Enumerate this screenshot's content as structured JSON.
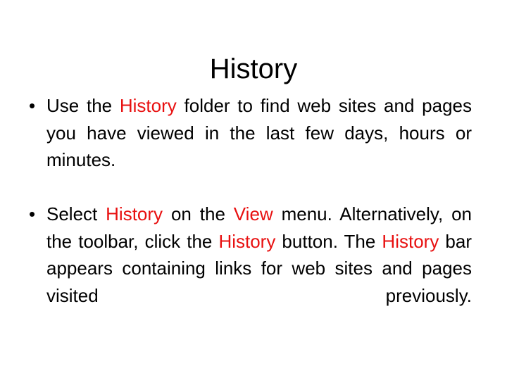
{
  "slide": {
    "title": "History",
    "title_color": "#000000",
    "background_color": "#ffffff",
    "highlight_color": "#e81010",
    "bullet_marker": "•",
    "bullets": [
      {
        "marker": "•",
        "full_text": "Use the History folder to find web sites and pages you have viewed in the last few days, hours or minutes.",
        "segments": [
          {
            "text": "Use the ",
            "highlight": false
          },
          {
            "text": "History",
            "highlight": true
          },
          {
            "text": " folder to find web sites and pages you have viewed in the last few days, hours or minutes.",
            "highlight": false
          }
        ]
      },
      {
        "marker": "•",
        "full_text": "Select History on the View menu. Alternatively, on the toolbar, click the History button. The History bar appears containing links for web sites and pages visited previously.",
        "segments": [
          {
            "text": "Select ",
            "highlight": false
          },
          {
            "text": "History",
            "highlight": true
          },
          {
            "text": " on the ",
            "highlight": false
          },
          {
            "text": "View",
            "highlight": true
          },
          {
            "text": " menu. Alternatively, on the toolbar, click the ",
            "highlight": false
          },
          {
            "text": "History",
            "highlight": true
          },
          {
            "text": " button. The ",
            "highlight": false
          },
          {
            "text": "History",
            "highlight": true
          },
          {
            "text": " bar appears containing links for web sites and pages visited previously.",
            "highlight": false
          }
        ]
      }
    ]
  }
}
